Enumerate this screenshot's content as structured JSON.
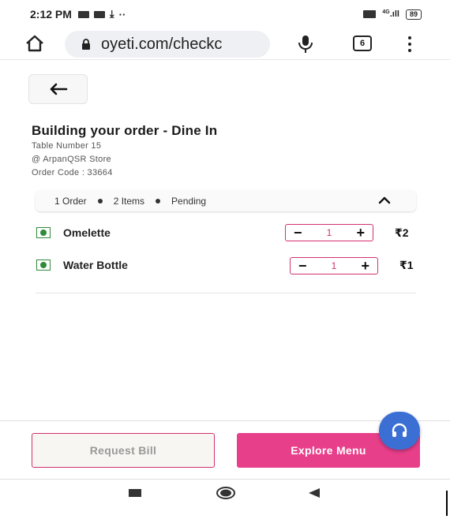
{
  "status_bar": {
    "time": "2:12 PM",
    "signal": "4G",
    "battery": "89"
  },
  "browser": {
    "url": "oyeti.com/checkc",
    "tab_count": "6"
  },
  "order": {
    "title": "Building your order - Dine In",
    "table": "Table Number 15",
    "store": "@ ArpanQSR Store",
    "code": "Order Code : 33664"
  },
  "summary": {
    "orders": "1 Order",
    "items": "2 Items",
    "status": "Pending"
  },
  "items": [
    {
      "name": "Omelette",
      "qty": "1",
      "price": "₹2"
    },
    {
      "name": "Water Bottle",
      "qty": "1",
      "price": "₹1"
    }
  ],
  "buttons": {
    "request_bill": "Request Bill",
    "explore_menu": "Explore Menu"
  },
  "colors": {
    "accent_pink": "#e83f8b",
    "veg_green": "#2f8a3a",
    "fab_blue": "#3c6fd3"
  }
}
